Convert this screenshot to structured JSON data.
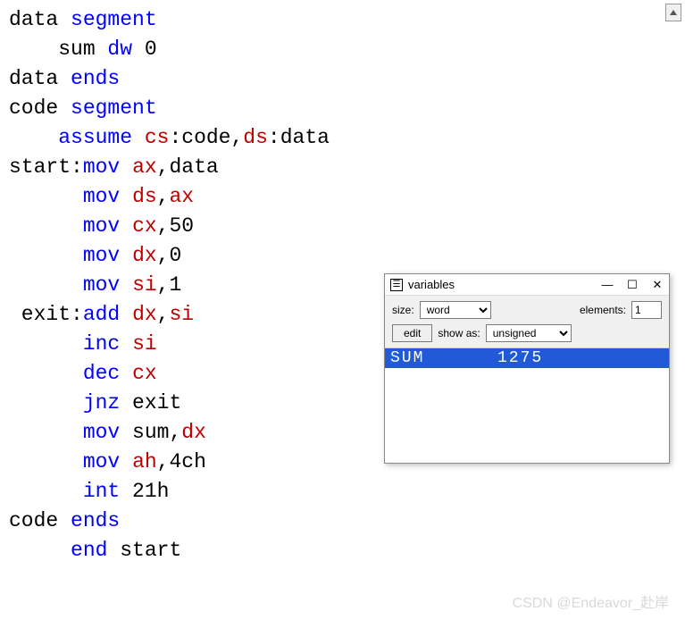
{
  "code": {
    "lines": [
      [
        [
          "txt",
          "data "
        ],
        [
          "kw-blue",
          "segment"
        ]
      ],
      [
        [
          "txt",
          "    sum "
        ],
        [
          "kw-blue",
          "dw"
        ],
        [
          "txt",
          " 0"
        ]
      ],
      [
        [
          "txt",
          "data "
        ],
        [
          "kw-blue",
          "ends"
        ]
      ],
      [
        [
          "txt",
          "code "
        ],
        [
          "kw-blue",
          "segment"
        ]
      ],
      [
        [
          "txt",
          "    "
        ],
        [
          "kw-blue",
          "assume"
        ],
        [
          "txt",
          " "
        ],
        [
          "kw-red",
          "cs"
        ],
        [
          "txt",
          ":code,"
        ],
        [
          "kw-red",
          "ds"
        ],
        [
          "txt",
          ":data"
        ]
      ],
      [
        [
          "txt",
          "start:"
        ],
        [
          "kw-blue",
          "mov"
        ],
        [
          "txt",
          " "
        ],
        [
          "kw-red",
          "ax"
        ],
        [
          "txt",
          ",data"
        ]
      ],
      [
        [
          "txt",
          "      "
        ],
        [
          "kw-blue",
          "mov"
        ],
        [
          "txt",
          " "
        ],
        [
          "kw-red",
          "ds"
        ],
        [
          "txt",
          ","
        ],
        [
          "kw-red",
          "ax"
        ]
      ],
      [
        [
          "txt",
          "      "
        ],
        [
          "kw-blue",
          "mov"
        ],
        [
          "txt",
          " "
        ],
        [
          "kw-red",
          "cx"
        ],
        [
          "txt",
          ",50"
        ]
      ],
      [
        [
          "txt",
          "      "
        ],
        [
          "kw-blue",
          "mov"
        ],
        [
          "txt",
          " "
        ],
        [
          "kw-red",
          "dx"
        ],
        [
          "txt",
          ",0"
        ]
      ],
      [
        [
          "txt",
          "      "
        ],
        [
          "kw-blue",
          "mov"
        ],
        [
          "txt",
          " "
        ],
        [
          "kw-red",
          "si"
        ],
        [
          "txt",
          ",1"
        ]
      ],
      [
        [
          "txt",
          " exit:"
        ],
        [
          "kw-blue",
          "add"
        ],
        [
          "txt",
          " "
        ],
        [
          "kw-red",
          "dx"
        ],
        [
          "txt",
          ","
        ],
        [
          "kw-red",
          "si"
        ]
      ],
      [
        [
          "txt",
          "      "
        ],
        [
          "kw-blue",
          "inc"
        ],
        [
          "txt",
          " "
        ],
        [
          "kw-red",
          "si"
        ]
      ],
      [
        [
          "txt",
          "      "
        ],
        [
          "kw-blue",
          "dec"
        ],
        [
          "txt",
          " "
        ],
        [
          "kw-red",
          "cx"
        ]
      ],
      [
        [
          "txt",
          "      "
        ],
        [
          "kw-blue",
          "jnz"
        ],
        [
          "txt",
          " exit"
        ]
      ],
      [
        [
          "txt",
          "      "
        ],
        [
          "kw-blue",
          "mov"
        ],
        [
          "txt",
          " sum,"
        ],
        [
          "kw-red",
          "dx"
        ]
      ],
      [
        [
          "txt",
          "      "
        ],
        [
          "kw-blue",
          "mov"
        ],
        [
          "txt",
          " "
        ],
        [
          "kw-red",
          "ah"
        ],
        [
          "txt",
          ",4ch"
        ]
      ],
      [
        [
          "txt",
          "      "
        ],
        [
          "kw-blue",
          "int"
        ],
        [
          "txt",
          " 21h"
        ]
      ],
      [
        [
          "txt",
          "code "
        ],
        [
          "kw-blue",
          "ends"
        ]
      ],
      [
        [
          "txt",
          "     "
        ],
        [
          "kw-blue",
          "end"
        ],
        [
          "txt",
          " start"
        ]
      ]
    ]
  },
  "variables_window": {
    "title": "variables",
    "size_label": "size:",
    "size_value": "word",
    "elements_label": "elements:",
    "elements_value": "1",
    "edit_label": "edit",
    "showas_label": "show as:",
    "showas_value": "unsigned",
    "rows": [
      {
        "name": "SUM",
        "value": "1275",
        "selected": true
      }
    ]
  },
  "watermark": "CSDN @Endeavor_赴岸"
}
